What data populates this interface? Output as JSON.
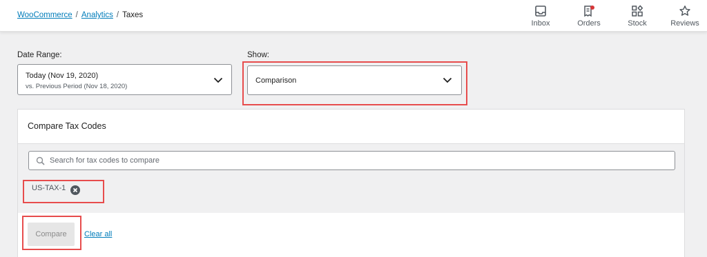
{
  "breadcrumb": {
    "root": "WooCommerce",
    "section": "Analytics",
    "current": "Taxes",
    "separator": "/"
  },
  "activity_panel": [
    {
      "label": "Inbox",
      "icon": "inbox-icon"
    },
    {
      "label": "Orders",
      "icon": "orders-icon",
      "badge_color": "#d63638"
    },
    {
      "label": "Stock",
      "icon": "stock-icon"
    },
    {
      "label": "Reviews",
      "icon": "star-icon"
    }
  ],
  "date_range": {
    "label": "Date Range:",
    "primary": "Today (Nov 19, 2020)",
    "secondary": "vs. Previous Period (Nov 18, 2020)"
  },
  "show": {
    "label": "Show:",
    "value": "Comparison"
  },
  "compare_panel": {
    "title": "Compare Tax Codes",
    "search_placeholder": "Search for tax codes to compare",
    "selected_tags": [
      "US-TAX-1"
    ],
    "compare_button": "Compare",
    "clear_all": "Clear all"
  },
  "colors": {
    "link": "#007cba",
    "highlight": "#e74c4c",
    "background": "#f0f0f1"
  }
}
